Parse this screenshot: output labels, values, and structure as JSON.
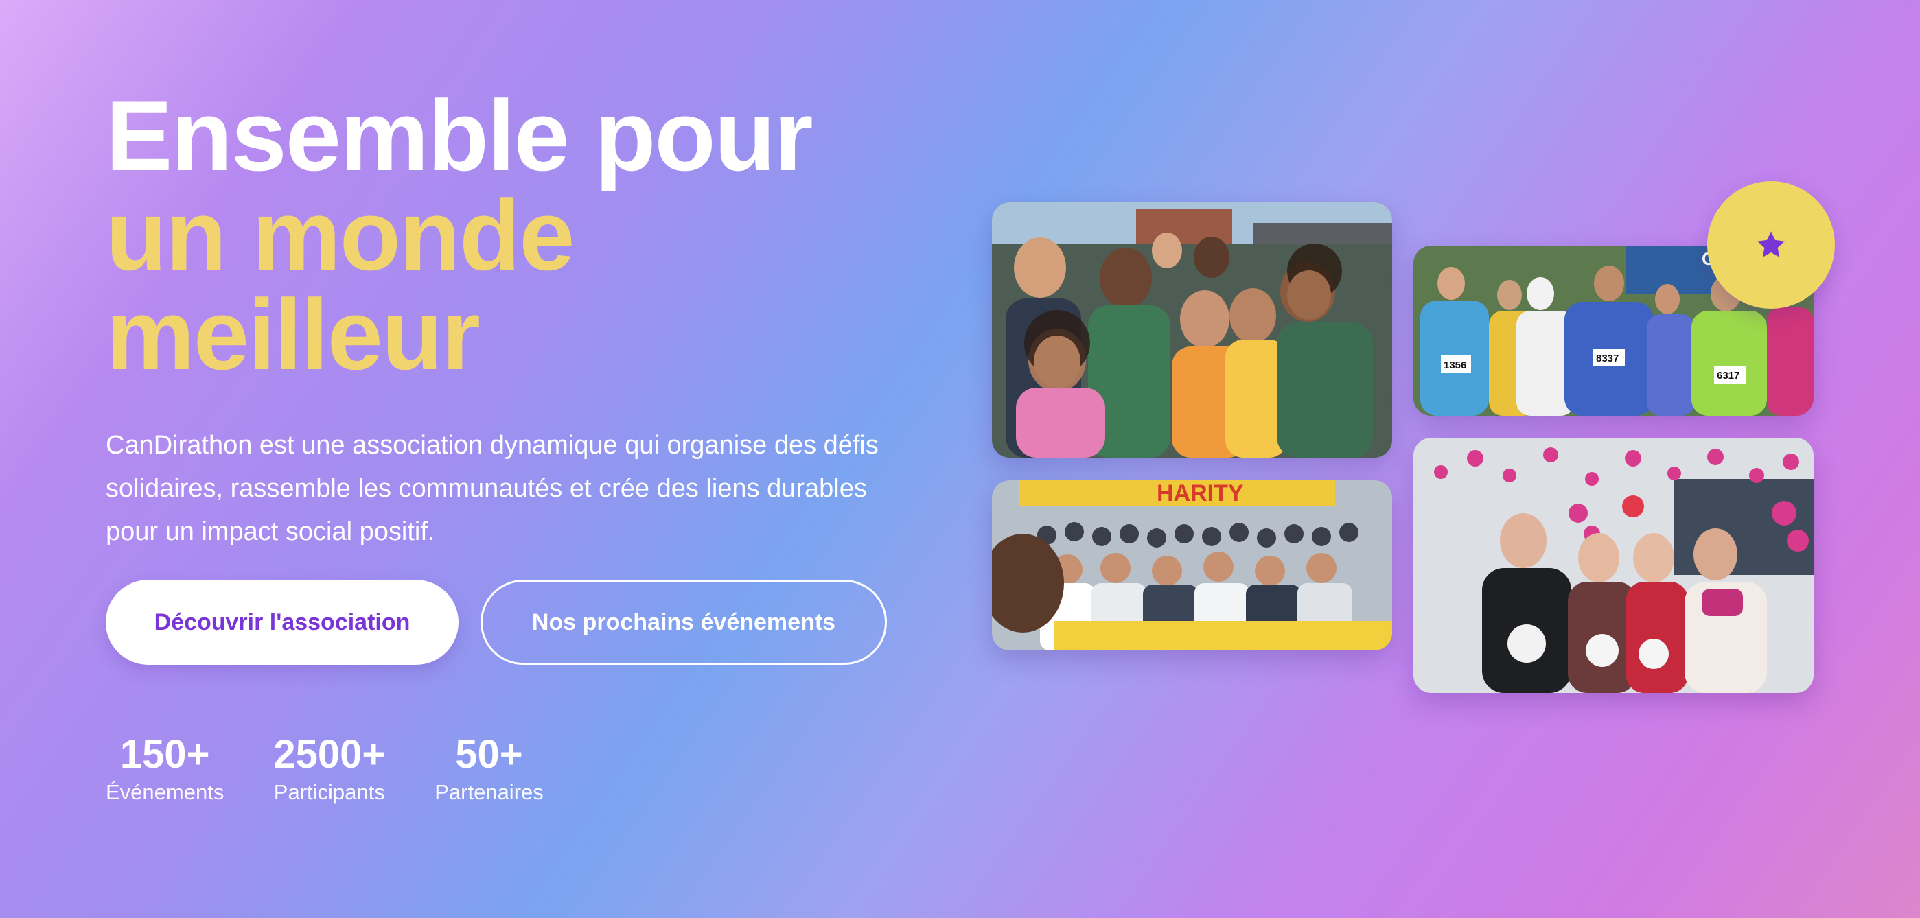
{
  "hero": {
    "title_line1": "Ensemble pour",
    "title_line2": "un monde",
    "title_line3": "meilleur",
    "description": "CanDirathon est une association dynamique qui organise des défis solidaires, rassemble les communautés et crée des liens durables pour un impact social positif."
  },
  "cta": {
    "primary_label": "Découvrir l'association",
    "secondary_label": "Nos prochains événements"
  },
  "stats": [
    {
      "value": "150+",
      "label": "Événements"
    },
    {
      "value": "2500+",
      "label": "Participants"
    },
    {
      "value": "50+",
      "label": "Partenaires"
    }
  ],
  "gallery": {
    "badge_icon": "star-icon",
    "photos": [
      {
        "name": "group-of-young-volunteers-photo"
      },
      {
        "name": "charity-crowd-banner-photo",
        "banner_text": "HARITY"
      },
      {
        "name": "charity-runners-photo",
        "sign_text": "Chape",
        "bibs": [
          "1356",
          "8337",
          "6317"
        ]
      },
      {
        "name": "seniors-celebration-photo"
      }
    ]
  },
  "colors": {
    "accent_yellow": "#f1d46e",
    "primary_purple": "#7a35d6",
    "white": "#ffffff"
  }
}
